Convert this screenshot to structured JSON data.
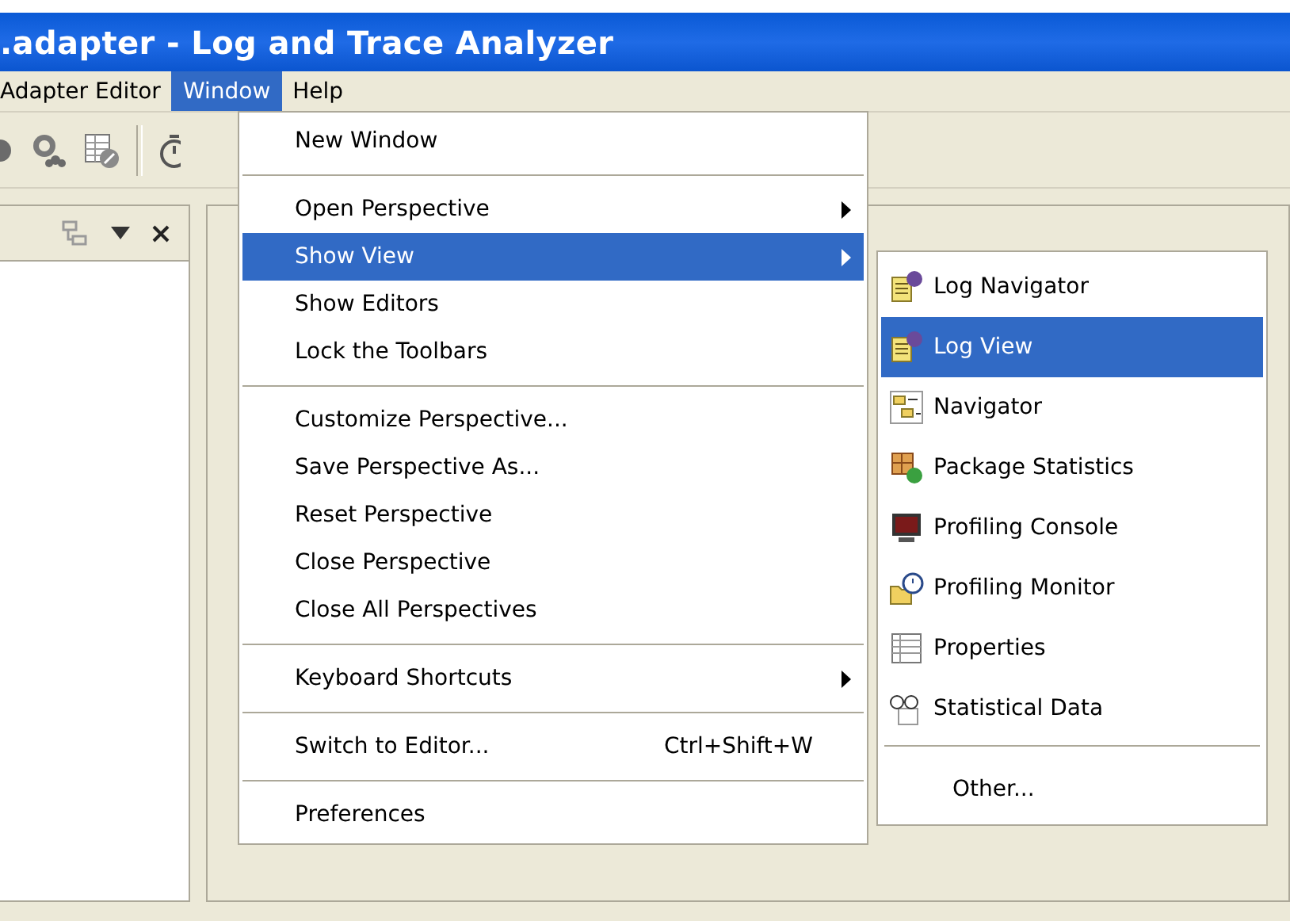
{
  "window": {
    "title": ".adapter - Log and Trace Analyzer"
  },
  "menu_bar": [
    {
      "label": "Adapter Editor",
      "selected": false
    },
    {
      "label": "Window",
      "selected": true
    },
    {
      "label": "Help",
      "selected": false
    }
  ],
  "window_menu": {
    "items": [
      {
        "kind": "item",
        "label": "New Window",
        "selected": false,
        "submenu": false
      },
      {
        "kind": "separator"
      },
      {
        "kind": "item",
        "label": "Open Perspective",
        "selected": false,
        "submenu": true
      },
      {
        "kind": "item",
        "label": "Show View",
        "selected": true,
        "submenu": true
      },
      {
        "kind": "item",
        "label": "Show Editors",
        "selected": false,
        "submenu": false
      },
      {
        "kind": "item",
        "label": "Lock the Toolbars",
        "selected": false,
        "submenu": false
      },
      {
        "kind": "separator"
      },
      {
        "kind": "item",
        "label": "Customize Perspective...",
        "selected": false,
        "submenu": false
      },
      {
        "kind": "item",
        "label": "Save Perspective As...",
        "selected": false,
        "submenu": false
      },
      {
        "kind": "item",
        "label": "Reset Perspective",
        "selected": false,
        "submenu": false
      },
      {
        "kind": "item",
        "label": "Close Perspective",
        "selected": false,
        "submenu": false
      },
      {
        "kind": "item",
        "label": "Close All Perspectives",
        "selected": false,
        "submenu": false
      },
      {
        "kind": "separator"
      },
      {
        "kind": "item",
        "label": "Keyboard Shortcuts",
        "selected": false,
        "submenu": true
      },
      {
        "kind": "separator"
      },
      {
        "kind": "item",
        "label": "Switch to Editor...",
        "shortcut": "Ctrl+Shift+W",
        "selected": false,
        "submenu": false
      },
      {
        "kind": "separator"
      },
      {
        "kind": "item",
        "label": "Preferences",
        "selected": false,
        "submenu": false
      }
    ]
  },
  "show_view_submenu": {
    "items": [
      {
        "kind": "item",
        "label": "Log Navigator",
        "selected": false
      },
      {
        "kind": "item",
        "label": "Log View",
        "selected": true
      },
      {
        "kind": "item",
        "label": "Navigator",
        "selected": false
      },
      {
        "kind": "item",
        "label": "Package Statistics",
        "selected": false
      },
      {
        "kind": "item",
        "label": "Profiling Console",
        "selected": false
      },
      {
        "kind": "item",
        "label": "Profiling Monitor",
        "selected": false
      },
      {
        "kind": "item",
        "label": "Properties",
        "selected": false
      },
      {
        "kind": "item",
        "label": "Statistical Data",
        "selected": false
      },
      {
        "kind": "separator"
      },
      {
        "kind": "item",
        "label": "Other...",
        "selected": false
      }
    ]
  }
}
